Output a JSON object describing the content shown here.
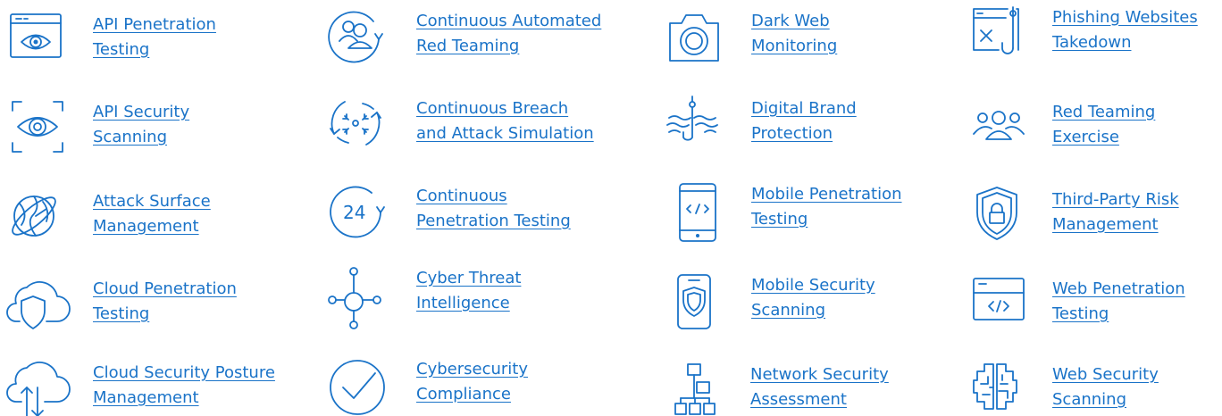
{
  "services": [
    {
      "icon": "eye-browser-icon",
      "lines": [
        "API Penetration",
        "Testing"
      ]
    },
    {
      "icon": "user-group-refresh-icon",
      "lines": [
        "Continuous Automated",
        "Red Teaming"
      ]
    },
    {
      "icon": "camera-icon",
      "lines": [
        "Dark Web",
        "Monitoring"
      ]
    },
    {
      "icon": "phishing-browser-icon",
      "lines": [
        "Phishing Websites",
        "Takedown"
      ]
    },
    {
      "icon": "eye-scan-icon",
      "lines": [
        "API Security",
        "Scanning"
      ]
    },
    {
      "icon": "breach-simulation-icon",
      "lines": [
        "Continuous Breach",
        "and Attack Simulation"
      ]
    },
    {
      "icon": "fish-hook-icon",
      "lines": [
        "Digital Brand",
        "Protection"
      ]
    },
    {
      "icon": "team-icon",
      "lines": [
        "Red Teaming",
        "Exercise"
      ]
    },
    {
      "icon": "globe-satellite-icon",
      "lines": [
        "Attack Surface",
        "Management"
      ]
    },
    {
      "icon": "24-hours-icon",
      "lines": [
        "Continuous",
        "Penetration Testing"
      ]
    },
    {
      "icon": "mobile-code-icon",
      "lines": [
        "Mobile Penetration",
        "Testing"
      ]
    },
    {
      "icon": "shield-lock-icon",
      "lines": [
        "Third-Party Risk",
        "Management"
      ]
    },
    {
      "icon": "cloud-shield-icon",
      "lines": [
        "Cloud Penetration",
        "Testing"
      ]
    },
    {
      "icon": "network-hub-icon",
      "lines": [
        "Cyber Threat",
        "Intelligence"
      ]
    },
    {
      "icon": "mobile-shield-icon",
      "lines": [
        "Mobile Security",
        "Scanning"
      ]
    },
    {
      "icon": "browser-code-icon",
      "lines": [
        "Web Penetration",
        "Testing"
      ]
    },
    {
      "icon": "cloud-arrows-icon",
      "lines": [
        "Cloud Security Posture",
        "Management"
      ]
    },
    {
      "icon": "checkmark-circle-icon",
      "lines": [
        "Cybersecurity",
        "Compliance"
      ]
    },
    {
      "icon": "hierarchy-icon",
      "lines": [
        "Network Security",
        "Assessment"
      ]
    },
    {
      "icon": "circuit-brain-icon",
      "lines": [
        "Web Security",
        "Scanning"
      ]
    }
  ],
  "colors": {
    "accent": "#1a73c8",
    "background": "#ffffff"
  }
}
